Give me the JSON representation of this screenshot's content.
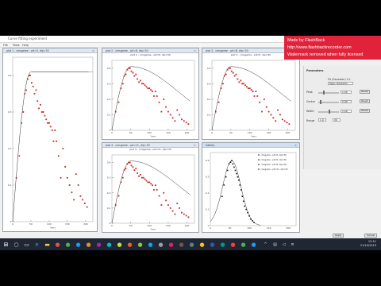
{
  "app": {
    "title": "Curve fitting experiment"
  },
  "menu": [
    "File",
    "Tools",
    "Help"
  ],
  "plots": {
    "left": {
      "title": "plot 1 - cmsgame - pit=5, dip=30"
    },
    "tr1": {
      "title": "plot 2 - cmsgame - pit=8, dip=30",
      "caption": "plot 2 - cmsgame - pit=8, dip=30"
    },
    "tr2": {
      "title": "plot 3 - cmsgame - pit=8, dip=30",
      "caption": "plot 3 - cmsgame - pit=5, dip=30"
    },
    "br1": {
      "title": "plot 4 - cmsgame - pit=11, dip=30",
      "caption": "plot 4 - cmsgame - pit=11, dip=30"
    },
    "br2": {
      "title": "Gallery",
      "legend": [
        "cmsgame - pit=5, dip=30",
        "cmsgame - pit=8, dip=30",
        "cmsgame - pit=8, dip=30",
        "cmsgame - pit=11, dip=30"
      ]
    }
  },
  "chart_data": [
    {
      "type": "scatter",
      "title": "",
      "ylim": [
        0,
        0.45
      ],
      "xlim": [
        0,
        220
      ],
      "xticks": [
        "0",
        "50",
        "100",
        "150",
        "200"
      ],
      "yticks": [
        "0",
        "0.1",
        "0.2",
        "0.3",
        "0.4"
      ],
      "xlabel": "Years",
      "series": [
        {
          "x": [
            10,
            18,
            24,
            29,
            33,
            37,
            41,
            45,
            48,
            52,
            56,
            60,
            64,
            68,
            72,
            76,
            80,
            84,
            88,
            92,
            96,
            100,
            104,
            108,
            112,
            116,
            120,
            126,
            132,
            138,
            144,
            150,
            156,
            162,
            168,
            174,
            180,
            186,
            192,
            198,
            204
          ],
          "y": [
            0.12,
            0.18,
            0.27,
            0.3,
            0.35,
            0.36,
            0.39,
            0.4,
            0.4,
            0.38,
            0.37,
            0.35,
            0.36,
            0.33,
            0.31,
            0.32,
            0.3,
            0.3,
            0.29,
            0.28,
            0.27,
            0.27,
            0.26,
            0.25,
            0.22,
            0.25,
            0.22,
            0.18,
            0.12,
            0.2,
            0.15,
            0.12,
            0.1,
            0.08,
            0.06,
            0.13,
            0.1,
            0.07,
            0.06,
            0.05,
            0.04
          ]
        }
      ]
    }
  ],
  "panel": {
    "heading": "Parameters",
    "sub1": "Fit (Gaussian) 2.1",
    "select": "Type: Gaussian",
    "rows": [
      {
        "label": "Peak",
        "value": "1.00",
        "button": "Reset"
      },
      {
        "label": "Center",
        "value": "2.00",
        "button": "Reset"
      },
      {
        "label": "Width",
        "value": "1.00",
        "button": "Reset"
      }
    ],
    "range_label": "Range",
    "range_from": "1.0",
    "range_to": "30"
  },
  "footer": {
    "btn1": "Apply",
    "btn2": "Cancel"
  },
  "watermark": {
    "line1": "Made by FlashBack",
    "line2": "http://www.flashbackrecorder.com",
    "line3": "Watermark removed when fully licensed"
  },
  "taskbar": {
    "time": "12:11",
    "date": "21/10/2019"
  }
}
